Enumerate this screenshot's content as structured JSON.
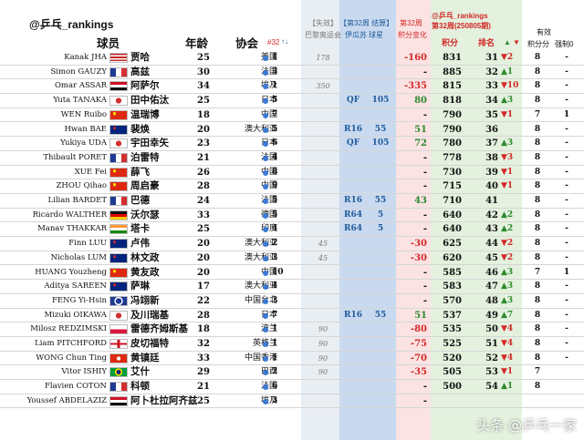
{
  "handle": "@乒乓_rankings",
  "headers": {
    "player": "球员",
    "age": "年龄",
    "assoc": "协会",
    "rank32": "#32",
    "rank32_arrows": "↑↓",
    "paris_tag": "【失效】",
    "paris_event": "巴黎奥运会",
    "week32_tag": "【第32周 结算】",
    "week32_event": "伊瓜苏",
    "ball_star": "球星",
    "change_tag": "第32周",
    "change_label": "积分变化",
    "right_handle": "@乒乓_rankings",
    "right_week": "第32周(250805期)",
    "points": "积分",
    "rank": "排名",
    "valid_tag": "有效",
    "valid": "积分分",
    "forced": "强制0"
  },
  "colors": {
    "red": "#d32828",
    "green": "#2d8a2d",
    "blue": "#1f5a9b"
  },
  "rows": [
    {
      "en": "Kanak JHA",
      "flag": "usa",
      "cn": "贾哈",
      "age": "25",
      "assoc": "美国",
      "dot": "#3a7bd5",
      "r32": "1",
      "paris": "178",
      "round": "",
      "pts": "",
      "chg": "-160",
      "chgc": "neg",
      "total": "831",
      "rank": "31",
      "mv": "▼2",
      "mvc": "down",
      "valid": "8",
      "forced": "-",
      "fc": ""
    },
    {
      "en": "Simon GAUZY",
      "flag": "fra",
      "cn": "高兹",
      "age": "30",
      "assoc": "法国",
      "dot": "#3a7bd5",
      "r32": "3",
      "paris": "",
      "round": "",
      "pts": "",
      "chg": "-",
      "chgc": "",
      "total": "885",
      "rank": "32",
      "mv": "▲1",
      "mvc": "up",
      "valid": "8",
      "forced": "-",
      "fc": ""
    },
    {
      "en": "Omar ASSAR",
      "flag": "egy",
      "cn": "阿萨尔",
      "age": "34",
      "assoc": "埃及",
      "dot": "#3a7bd5",
      "r32": "1",
      "paris": "350",
      "round": "",
      "pts": "",
      "chg": "-335",
      "chgc": "neg",
      "total": "815",
      "rank": "33",
      "mv": "▼10",
      "mvc": "down",
      "valid": "8",
      "forced": "-",
      "fc": ""
    },
    {
      "en": "Yuta TANAKA",
      "flag": "jpn",
      "cn": "田中佑汰",
      "age": "25",
      "assoc": "日本",
      "dot": "#3a7bd5",
      "r32": "5",
      "paris": "",
      "round": "QF",
      "pts": "105",
      "chg": "80",
      "chgc": "pos",
      "total": "818",
      "rank": "34",
      "mv": "▲3",
      "mvc": "up",
      "valid": "8",
      "forced": "-",
      "fc": ""
    },
    {
      "en": "WEN Ruibo",
      "flag": "chn",
      "cn": "温瑞博",
      "age": "18",
      "assoc": "中国",
      "dot": "#3a7bd5",
      "r32": "7",
      "paris": "",
      "round": "",
      "pts": "",
      "chg": "-",
      "chgc": "",
      "total": "790",
      "rank": "35",
      "mv": "▼1",
      "mvc": "down",
      "valid": "7",
      "forced": "1",
      "fc": ""
    },
    {
      "en": "Hwan BAE",
      "flag": "aus",
      "cn": "裴焕",
      "age": "20",
      "assoc": "澳大利亚",
      "dot": "#3a7bd5",
      "r32": "5",
      "paris": "",
      "round": "R16",
      "pts": "55",
      "chg": "51",
      "chgc": "pos",
      "total": "790",
      "rank": "36",
      "mv": "",
      "mvc": "",
      "valid": "8",
      "forced": "-",
      "fc": ""
    },
    {
      "en": "Yukiya UDA",
      "flag": "jpn",
      "cn": "宇田幸矢",
      "age": "23",
      "assoc": "日本",
      "dot": "#3a7bd5",
      "r32": "6",
      "paris": "",
      "round": "QF",
      "pts": "105",
      "chg": "72",
      "chgc": "pos",
      "total": "780",
      "rank": "37",
      "mv": "▲3",
      "mvc": "up",
      "valid": "8",
      "forced": "-",
      "fc": ""
    },
    {
      "en": "Thibault PORET",
      "flag": "fra",
      "cn": "泊雷特",
      "age": "21",
      "assoc": "法国",
      "dot": "#3a7bd5",
      "r32": "4",
      "paris": "",
      "round": "",
      "pts": "",
      "chg": "-",
      "chgc": "",
      "total": "778",
      "rank": "38",
      "mv": "▼3",
      "mvc": "down",
      "valid": "8",
      "forced": "-",
      "fc": ""
    },
    {
      "en": "XUE Fei",
      "flag": "chn",
      "cn": "薛飞",
      "age": "26",
      "assoc": "中国",
      "dot": "#3a7bd5",
      "r32": "8",
      "paris": "",
      "round": "",
      "pts": "",
      "chg": "-",
      "chgc": "",
      "total": "730",
      "rank": "39",
      "mv": "▼1",
      "mvc": "down",
      "valid": "8",
      "forced": "-",
      "fc": ""
    },
    {
      "en": "ZHOU Qihao",
      "flag": "chn",
      "cn": "周启豪",
      "age": "28",
      "assoc": "中国",
      "dot": "#3a7bd5",
      "r32": "9",
      "paris": "",
      "round": "",
      "pts": "",
      "chg": "-",
      "chgc": "",
      "total": "715",
      "rank": "40",
      "mv": "▼1",
      "mvc": "down",
      "valid": "8",
      "forced": "-",
      "fc": ""
    },
    {
      "en": "Lilian BARDET",
      "flag": "fra",
      "cn": "巴德",
      "age": "24",
      "assoc": "法国",
      "dot": "#3a7bd5",
      "r32": "5",
      "paris": "",
      "round": "R16",
      "pts": "55",
      "chg": "43",
      "chgc": "pos",
      "total": "710",
      "rank": "41",
      "mv": "",
      "mvc": "",
      "valid": "8",
      "forced": "-",
      "fc": ""
    },
    {
      "en": "Ricardo WALTHER",
      "flag": "ger",
      "cn": "沃尔瑟",
      "age": "33",
      "assoc": "德国",
      "dot": "#3a7bd5",
      "r32": "5",
      "paris": "",
      "round": "R64",
      "pts": "5",
      "chg": "-",
      "chgc": "",
      "total": "640",
      "rank": "42",
      "mv": "▲2",
      "mvc": "up",
      "valid": "8",
      "forced": "-",
      "fc": ""
    },
    {
      "en": "Manav THAKKAR",
      "flag": "ind",
      "cn": "塔卡",
      "age": "25",
      "assoc": "印度",
      "dot": "#3a7bd5",
      "r32": "4",
      "paris": "",
      "round": "R64",
      "pts": "5",
      "chg": "-",
      "chgc": "",
      "total": "640",
      "rank": "43",
      "mv": "▲2",
      "mvc": "up",
      "valid": "8",
      "forced": "-",
      "fc": ""
    },
    {
      "en": "Finn LUU",
      "flag": "aus",
      "cn": "卢伟",
      "age": "20",
      "assoc": "澳大利亚",
      "dot": "#3a7bd5",
      "r32": "2",
      "paris": "45",
      "round": "",
      "pts": "",
      "chg": "-30",
      "chgc": "neg",
      "total": "625",
      "rank": "44",
      "mv": "▼2",
      "mvc": "down",
      "valid": "8",
      "forced": "-",
      "fc": ""
    },
    {
      "en": "Nicholas LUM",
      "flag": "aus",
      "cn": "林文政",
      "age": "20",
      "assoc": "澳大利亚",
      "dot": "#3a7bd5",
      "r32": "3",
      "paris": "45",
      "round": "",
      "pts": "",
      "chg": "-30",
      "chgc": "neg",
      "total": "620",
      "rank": "45",
      "mv": "▼2",
      "mvc": "down",
      "valid": "8",
      "forced": "-",
      "fc": ""
    },
    {
      "en": "HUANG Youzheng",
      "flag": "chn",
      "cn": "黄友政",
      "age": "20",
      "assoc": "中国",
      "dot": "#3a7bd5",
      "r32": "10",
      "paris": "",
      "round": "",
      "pts": "",
      "chg": "-",
      "chgc": "",
      "total": "585",
      "rank": "46",
      "mv": "▲3",
      "mvc": "up",
      "valid": "7",
      "forced": "1",
      "fc": ""
    },
    {
      "en": "Aditya SAREEN",
      "flag": "aus",
      "cn": "萨琳",
      "age": "17",
      "assoc": "澳大利亚",
      "dot": "#3a7bd5",
      "r32": "4",
      "paris": "",
      "round": "",
      "pts": "",
      "chg": "-",
      "chgc": "",
      "total": "583",
      "rank": "47",
      "mv": "▲3",
      "mvc": "up",
      "valid": "8",
      "forced": "-",
      "fc": ""
    },
    {
      "en": "FENG Yi-Hsin",
      "flag": "tpe",
      "cn": "冯翊新",
      "age": "22",
      "assoc": "中国台北",
      "dot": "#3a7bd5",
      "r32": "3",
      "paris": "",
      "round": "",
      "pts": "",
      "chg": "-",
      "chgc": "",
      "total": "570",
      "rank": "48",
      "mv": "▲3",
      "mvc": "up",
      "valid": "8",
      "forced": "-",
      "fc": ""
    },
    {
      "en": "Mizuki OIKAWA",
      "flag": "jpn",
      "cn": "及川瑞基",
      "age": "28",
      "assoc": "日本",
      "dot": "#3a7bd5",
      "r32": "7",
      "paris": "",
      "round": "R16",
      "pts": "55",
      "chg": "51",
      "chgc": "pos",
      "total": "537",
      "rank": "49",
      "mv": "▲7",
      "mvc": "up",
      "valid": "8",
      "forced": "-",
      "fc": ""
    },
    {
      "en": "Milosz REDZIMSKI",
      "flag": "pol",
      "cn": "雷德齐姆斯基",
      "age": "18",
      "assoc": "波兰",
      "dot": "#3a7bd5",
      "r32": "1",
      "paris": "90",
      "round": "",
      "pts": "",
      "chg": "-80",
      "chgc": "neg",
      "total": "535",
      "rank": "50",
      "mv": "▼4",
      "mvc": "down",
      "valid": "8",
      "forced": "-",
      "fc": ""
    },
    {
      "en": "Liam PITCHFORD",
      "flag": "eng",
      "cn": "皮切福特",
      "age": "32",
      "assoc": "英格兰",
      "dot": "#3a7bd5",
      "r32": "1",
      "paris": "90",
      "round": "",
      "pts": "",
      "chg": "-75",
      "chgc": "neg",
      "total": "525",
      "rank": "51",
      "mv": "▼4",
      "mvc": "down",
      "valid": "8",
      "forced": "-",
      "fc": ""
    },
    {
      "en": "WONG Chun Ting",
      "flag": "hkg",
      "cn": "黄镇廷",
      "age": "33",
      "assoc": "中国香港",
      "dot": "#3a7bd5",
      "r32": "1",
      "paris": "90",
      "round": "",
      "pts": "",
      "chg": "-70",
      "chgc": "neg",
      "total": "520",
      "rank": "52",
      "mv": "▼4",
      "mvc": "down",
      "valid": "8",
      "forced": "-",
      "fc": ""
    },
    {
      "en": "Vitor ISHIY",
      "flag": "bra",
      "cn": "艾什",
      "age": "29",
      "assoc": "巴西",
      "dot": "#3a7bd5",
      "r32": "2",
      "paris": "90",
      "round": "",
      "pts": "",
      "chg": "-35",
      "chgc": "neg",
      "total": "505",
      "rank": "53",
      "mv": "▼1",
      "mvc": "down",
      "valid": "7",
      "forced": "",
      "fc": ""
    },
    {
      "en": "Flavien COTON",
      "flag": "fra",
      "cn": "科顿",
      "age": "21",
      "assoc": "法国",
      "dot": "#3a7bd5",
      "r32": "6",
      "paris": "",
      "round": "",
      "pts": "",
      "chg": "-",
      "chgc": "",
      "total": "500",
      "rank": "54",
      "mv": "▲1",
      "mvc": "up",
      "valid": "8",
      "forced": "",
      "fc": ""
    },
    {
      "en": "Youssef ABDELAZIZ",
      "flag": "egy",
      "cn": "阿卜杜拉阿齐兹",
      "age": "25",
      "assoc": "埃及",
      "dot": "#3a7bd5",
      "r32": "3",
      "paris": "",
      "round": "",
      "pts": "",
      "chg": "-",
      "chgc": "",
      "total": "",
      "rank": "",
      "mv": "",
      "mvc": "",
      "valid": "",
      "forced": "",
      "fc": ""
    }
  ],
  "watermark": "头条 @乒乓一家"
}
